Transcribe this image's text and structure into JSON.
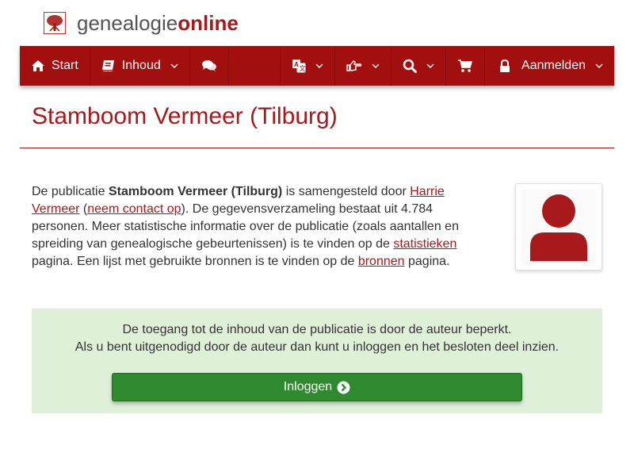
{
  "logo": {
    "part1": "genealogie",
    "part2": "online"
  },
  "nav": {
    "start": "Start",
    "inhoud": "Inhoud",
    "aanmelden": "Aanmelden"
  },
  "page": {
    "title": "Stamboom Vermeer (Tilburg)"
  },
  "description": {
    "t1": "De publicatie ",
    "pub_name": "Stamboom Vermeer (Tilburg)",
    "t2": " is samengesteld door ",
    "author_link": "Harrie Vermeer",
    "t3": " (",
    "contact_link": "neem contact op",
    "t4": "). De gegevensverzameling bestaat uit 4.784 personen. Meer statistische informatie over de publicatie (zoals aantallen en spreiding van genealogische gebeurtenissen) is te vinden op de ",
    "stats_link": "statistieken",
    "t5": " pagina. Een lijst met gebruikte bronnen is te vinden op de ",
    "sources_link": "bronnen",
    "t6": " pagina."
  },
  "notice": {
    "line1": "De toegang tot de inhoud van de publicatie is door de auteur beperkt.",
    "line2": "Als u bent uitgenodigd door de auteur dan kunt u inloggen en het besloten deel inzien.",
    "button": "Inloggen"
  },
  "colors": {
    "brand": "#a10f0f",
    "success": "#2f8a2f",
    "notice_bg": "#dff0d8"
  }
}
